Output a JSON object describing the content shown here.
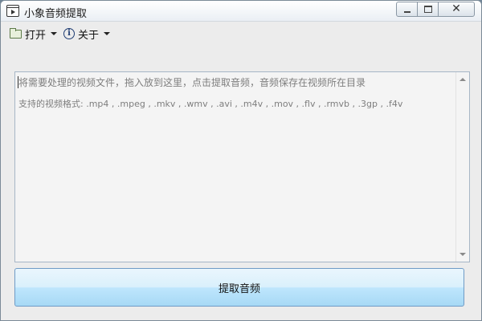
{
  "window": {
    "title": "小象音频提取",
    "close_glyph": "✕"
  },
  "menu": {
    "open_label": "打开",
    "about_label": "关于",
    "info_glyph": "i"
  },
  "textarea": {
    "line1": "将需要处理的视频文件，拖入放到这里，点击提取音频，音频保存在视频所在目录",
    "line2": "支持的视频格式: .mp4 , .mpeg , .mkv , .wmv , .avi , .m4v , .mov , .flv , .rmvb , .3gp , .f4v"
  },
  "extract_button": {
    "label": "提取音频"
  },
  "icons": {
    "app": "video-app-icon",
    "open": "folder-icon",
    "about": "info-icon"
  },
  "colors": {
    "button_gradient_top": "#eaf6fd",
    "button_gradient_bottom": "#a7d9f5",
    "placeholder_text": "#7e7e7e"
  }
}
